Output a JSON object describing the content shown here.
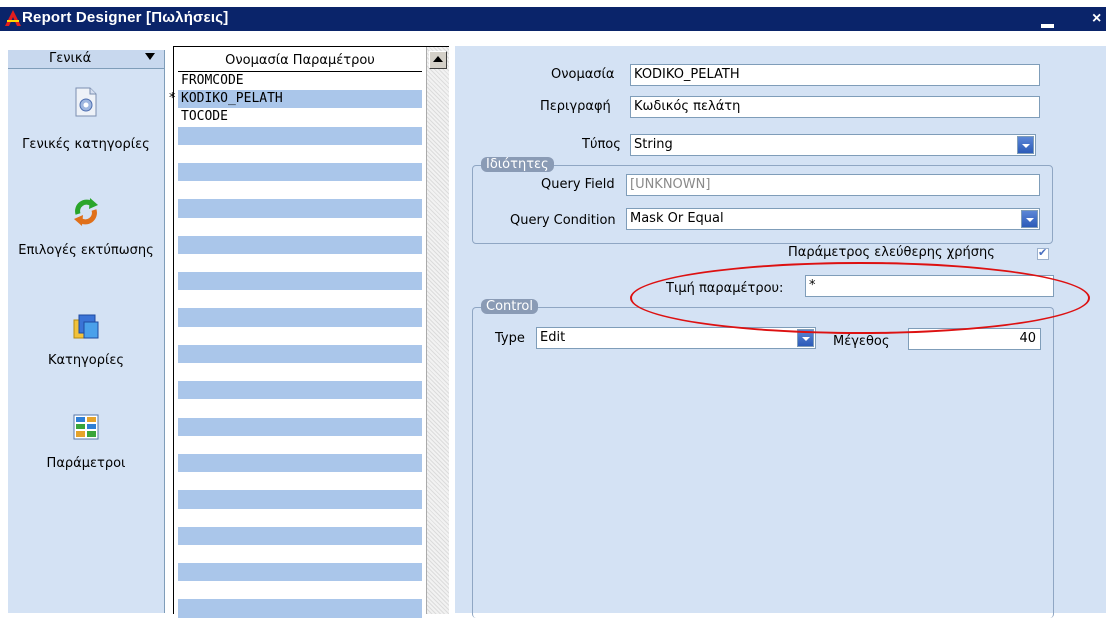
{
  "window": {
    "title": "Report Designer [Πωλήσεις]",
    "minimize_glyph": "_",
    "close_glyph": "×"
  },
  "sidebar": {
    "header": "Γενικά",
    "items": [
      {
        "label": "Γενικές κατηγορίες",
        "icon": "document-gear-icon"
      },
      {
        "label": "Επιλογές εκτύπωσης",
        "icon": "refresh-arrows-icon"
      },
      {
        "label": "Κατηγορίες",
        "icon": "folders-icon"
      },
      {
        "label": "Παράμετροι",
        "icon": "parameters-grid-icon"
      }
    ]
  },
  "param_list": {
    "header": "Ονομασία Παραμέτρου",
    "current_marker": "*",
    "rows": [
      "FROMCODE",
      "KODIKO_PELATH",
      "TOCODE",
      "",
      "",
      "",
      "",
      "",
      "",
      "",
      "",
      "",
      "",
      "",
      "",
      "",
      "",
      "",
      "",
      "",
      "",
      "",
      "",
      "",
      "",
      "",
      "",
      "",
      "",
      ""
    ]
  },
  "form": {
    "name_label": "Ονομασία",
    "name_value": "KODIKO_PELATH",
    "description_label": "Περιγραφή",
    "description_value": "Κωδικός πελάτη",
    "type_label": "Τύπος",
    "type_value": "String",
    "properties_group": {
      "title": "Ιδιότητες",
      "query_field_label": "Query Field",
      "query_field_value": "[UNKNOWN]",
      "query_condition_label": "Query Condition",
      "query_condition_value": "Mask Or Equal"
    },
    "free_use_label": "Παράμετρος ελεύθερης χρήσης",
    "free_use_checked": true,
    "param_value_label": "Τιμή παραμέτρου:",
    "param_value": "*",
    "control_group": {
      "title": "Control",
      "type_label": "Type",
      "type_value": "Edit",
      "size_label": "Μέγεθος",
      "size_value": "40"
    }
  },
  "colors": {
    "titlebar": "#0a246a",
    "panel": "#d4e2f4",
    "row_alt": "#aac6ea",
    "annotation": "#dd1111"
  }
}
